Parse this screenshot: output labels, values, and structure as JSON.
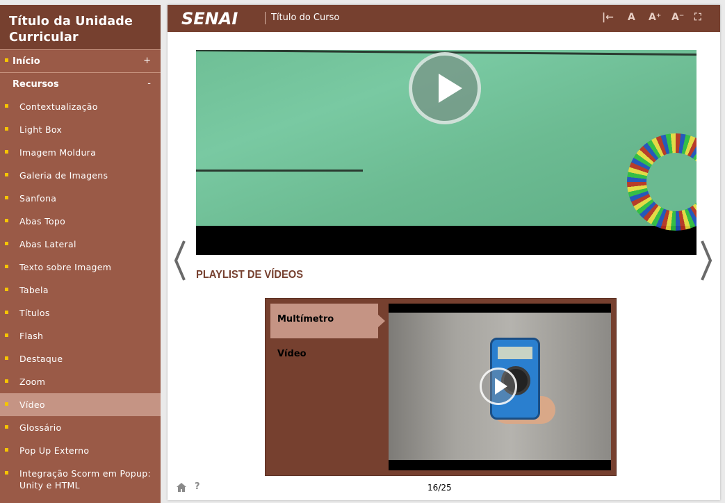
{
  "sidebar": {
    "title": "Título da Unidade Curricular",
    "sections": [
      {
        "label": "Início",
        "toggle": "+"
      },
      {
        "label": "Recursos",
        "toggle": "-"
      }
    ],
    "items": [
      "Contextualização",
      "Light Box",
      "Imagem Moldura",
      "Galeria de Imagens",
      "Sanfona",
      "Abas Topo",
      "Abas Lateral",
      "Texto sobre Imagem",
      "Tabela",
      "Títulos",
      "Flash",
      "Destaque",
      "Zoom",
      "Vídeo",
      "Glossário",
      "Pop Up Externo",
      "Integração Scorm em Popup: Unity e HTML"
    ],
    "active_item": "Vídeo",
    "bullet_color": "#f6c500"
  },
  "header": {
    "logo": "SENAI",
    "course_title": "Título do Curso",
    "tools": [
      "|←",
      "A",
      "A⁺",
      "A⁻",
      "⛶"
    ]
  },
  "main": {
    "playlist_title": "PLAYLIST DE VÍDEOS",
    "playlist_items": [
      "Multímetro",
      "Vídeo"
    ],
    "playlist_active": "Multímetro"
  },
  "footer": {
    "home_icon": "home-icon",
    "help": "?",
    "page": "16/25"
  },
  "colors": {
    "brand_dark": "#76402f",
    "sidebar_bg": "#9a5a47",
    "active_bg": "#c59484"
  }
}
